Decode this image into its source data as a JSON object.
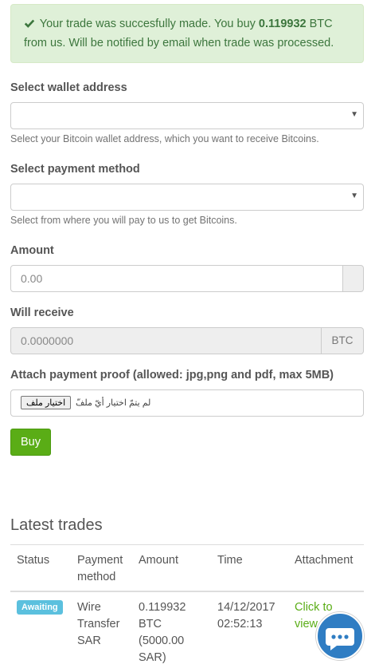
{
  "alert": {
    "message_pre": "Your trade was succesfully made. You buy",
    "amount": "0.119932",
    "message_post": "BTC",
    "line2": "from us. Will be notified by email when trade was processed."
  },
  "form": {
    "wallet": {
      "label": "Select wallet address",
      "help": "Select your Bitcoin wallet address, which you want to receive Bitcoins."
    },
    "payment": {
      "label": "Select payment method",
      "help": "Select from where you will pay to us to get Bitcoins."
    },
    "amount": {
      "label": "Amount",
      "value": "0.00"
    },
    "receive": {
      "label": "Will receive",
      "value": "0.0000000",
      "unit": "BTC"
    },
    "proof": {
      "label": "Attach payment proof (allowed: jpg,png and pdf, max 5MB)",
      "button": "اختيار ملف",
      "status": "لم يتمّ اختيار أيّ ملفّ"
    },
    "buy_label": "Buy"
  },
  "trades": {
    "title": "Latest trades",
    "columns": {
      "status": "Status",
      "payment_1": "Payment",
      "payment_2": "method",
      "amount": "Amount",
      "time": "Time",
      "attachment": "Attachment"
    },
    "rows": [
      {
        "status": "Awaiting",
        "method": [
          "Wire",
          "Transfer",
          "SAR"
        ],
        "amount": [
          "0.119932",
          "BTC",
          "(5000.00",
          "SAR)"
        ],
        "time": [
          "14/12/2017",
          "02:52:13"
        ],
        "attachment": [
          "Click to",
          "view"
        ]
      }
    ]
  },
  "colors": {
    "success_bg": "#dff0d8",
    "success_text": "#3c763d",
    "buy_button": "#5aad16",
    "badge": "#5bc0de",
    "chat": "#2f7dc3"
  },
  "icons": {
    "alert": "check-icon",
    "select": "caret-down-icon",
    "chat": "chat-bubble-icon"
  }
}
